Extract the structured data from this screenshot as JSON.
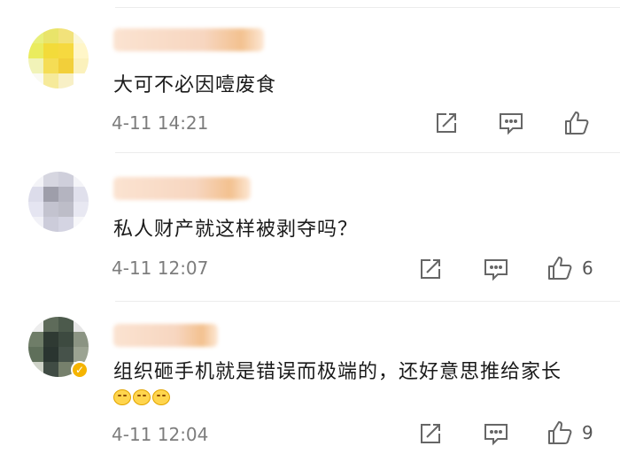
{
  "comments": [
    {
      "text": "大可不必因噎废食",
      "time": "4-11 14:21",
      "likes": "",
      "emojis": []
    },
    {
      "text": "私人财产就这样被剥夺吗？",
      "time": "4-11 12:07",
      "likes": "6",
      "emojis": []
    },
    {
      "text": "组织砸手机就是错误而极端的，还好意思推给家长",
      "time": "4-11 12:04",
      "likes": "9",
      "emojis": [
        "grimace-emoji",
        "grimace-emoji",
        "grimace-emoji"
      ]
    }
  ],
  "icons": {
    "share": "share-icon",
    "reply": "comment-icon",
    "like": "thumbs-up-icon"
  },
  "colors": {
    "text": "#1a1a1a",
    "meta": "#7d7d7d",
    "icon": "#666666",
    "verified": "#f5b400"
  }
}
